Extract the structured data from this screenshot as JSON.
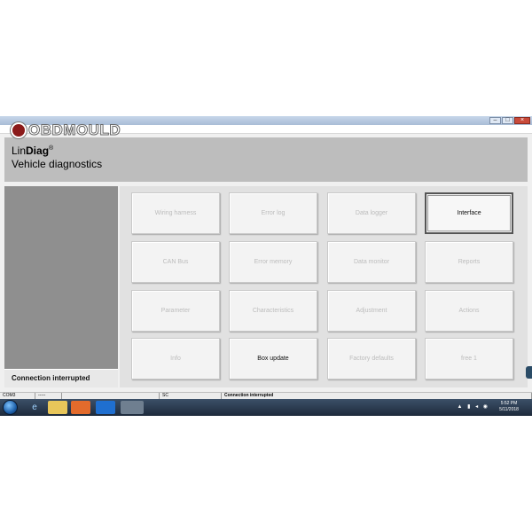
{
  "logo": {
    "text": "OBDMOULD"
  },
  "header": {
    "app_name_plain": "Lin",
    "app_name_bold": "Diag",
    "app_name_mark": "®",
    "subtitle": "Vehicle diagnostics"
  },
  "left_panel": {
    "status": "Connection interrupted"
  },
  "buttons": [
    {
      "label": "Wiring harness",
      "enabled": false
    },
    {
      "label": "Error log",
      "enabled": false
    },
    {
      "label": "Data logger",
      "enabled": false
    },
    {
      "label": "Interface",
      "enabled": true,
      "selected": true
    },
    {
      "label": "CAN Bus",
      "enabled": false
    },
    {
      "label": "Error memory",
      "enabled": false
    },
    {
      "label": "Data monitor",
      "enabled": false
    },
    {
      "label": "Reports",
      "enabled": false
    },
    {
      "label": "Parameter",
      "enabled": false
    },
    {
      "label": "Characteristics",
      "enabled": false
    },
    {
      "label": "Adjustment",
      "enabled": false
    },
    {
      "label": "Actions",
      "enabled": false
    },
    {
      "label": "Info",
      "enabled": false
    },
    {
      "label": "Box update",
      "enabled": true
    },
    {
      "label": "Factory defaults",
      "enabled": false
    },
    {
      "label": "free 1",
      "enabled": false
    }
  ],
  "statusbar": {
    "port": "COM3",
    "dash": "-----",
    "code": "SC",
    "message": "Connection interrupted"
  },
  "taskbar": {
    "time": "5:52 PM",
    "date": "5/11/2018"
  },
  "window_controls": {
    "minimize": "–",
    "maximize": "□",
    "close": "×"
  }
}
